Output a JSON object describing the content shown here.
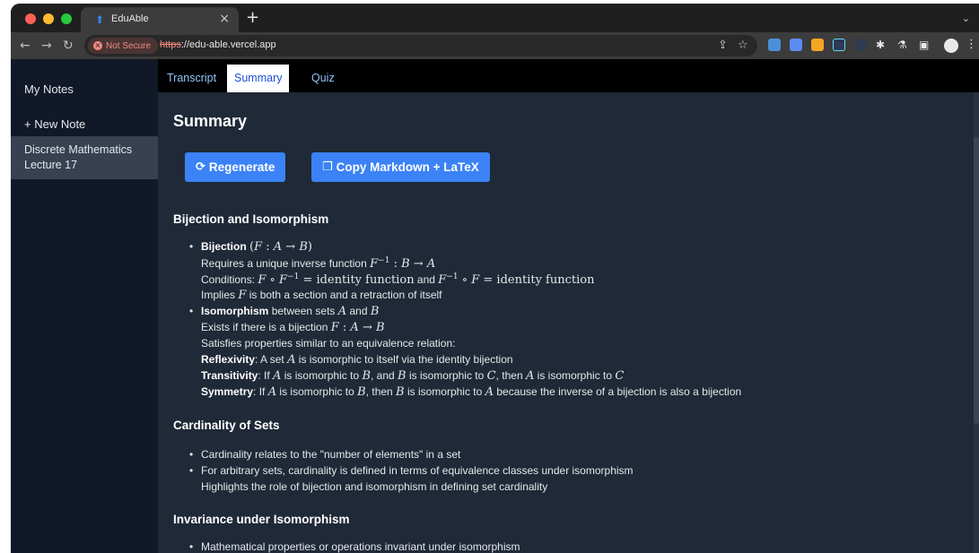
{
  "browser": {
    "tab_title": "EduAble",
    "security_label": "Not Secure",
    "url_scheme": "https",
    "url_rest": "://edu-able.vercel.app"
  },
  "sidebar": {
    "title": "My Notes",
    "new_note": "+ New Note",
    "items": [
      {
        "line1": "Discrete Mathematics",
        "line2": "Lecture 17"
      }
    ]
  },
  "tabs": [
    "Transcript",
    "Summary",
    "Quiz"
  ],
  "active_tab": "Summary",
  "summary": {
    "title": "Summary",
    "regenerate_label": "Regenerate",
    "copy_label": "Copy Markdown + LaTeX",
    "sections": [
      {
        "heading": "Bijection and Isomorphism",
        "lines": [
          "Bijection (F : A → B)",
          "Requires a unique inverse function F⁻¹ : B → A",
          "Conditions: F ∘ F⁻¹ = identity function and F⁻¹ ∘ F = identity function",
          "Implies F is both a section and a retraction of itself",
          "Isomorphism between sets A and B",
          "Exists if there is a bijection F : A → B",
          "Satisfies properties similar to an equivalence relation:",
          "Reflexivity: A set A is isomorphic to itself via the identity bijection",
          "Transitivity: If A is isomorphic to B, and B is isomorphic to C, then A is isomorphic to C",
          "Symmetry: If A is isomorphic to B, then B is isomorphic to A because the inverse of a bijection is also a bijection"
        ]
      },
      {
        "heading": "Cardinality of Sets",
        "lines": [
          "Cardinality relates to the \"number of elements\" in a set",
          "For arbitrary sets, cardinality is defined in terms of equivalence classes under isomorphism",
          "Highlights the role of bijection and isomorphism in defining set cardinality"
        ]
      },
      {
        "heading": "Invariance under Isomorphism",
        "lines": [
          "Mathematical properties or operations invariant under isomorphism"
        ]
      }
    ]
  }
}
